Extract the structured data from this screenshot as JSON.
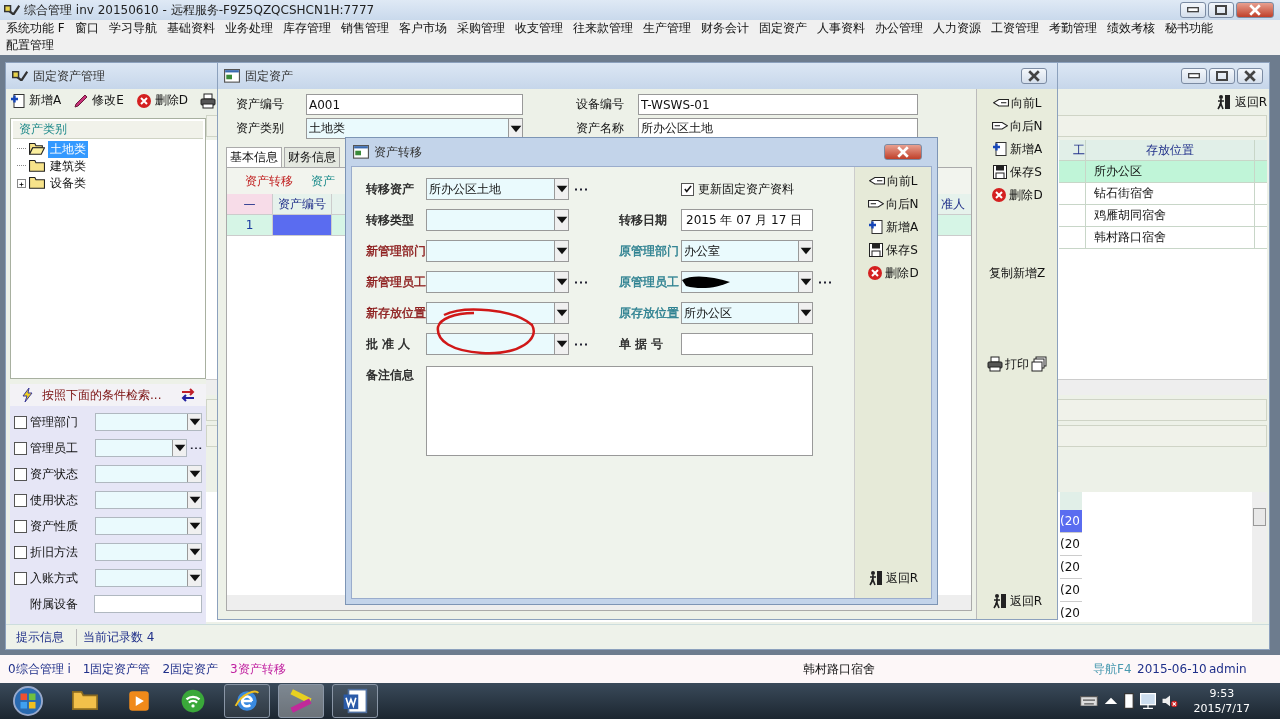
{
  "title_bar": {
    "title": "综合管理 inv 20150610 - 远程服务-F9Z5QZQCSHCN1H:7777"
  },
  "menu": [
    "系统功能 F",
    "窗口",
    "学习导航",
    "基础资料",
    "业务处理",
    "库存管理",
    "销售管理",
    "客户市场",
    "采购管理",
    "收支管理",
    "往来款管理",
    "生产管理",
    "财务会计",
    "固定资产",
    "人事资料",
    "办公管理",
    "人力资源",
    "工资管理",
    "考勤管理",
    "绩效考核",
    "秘书功能",
    "配置管理"
  ],
  "asset_manager": {
    "title": "固定资产管理",
    "toolbar": [
      {
        "label": "新增A",
        "kind": "new"
      },
      {
        "label": "修改E",
        "kind": "edit"
      },
      {
        "label": "删除D",
        "kind": "delete"
      },
      {
        "kind": "print"
      }
    ],
    "tree_header": "资产类别",
    "tree": [
      {
        "label": "土地类",
        "selected": true,
        "expandable": false
      },
      {
        "label": "建筑类",
        "selected": false,
        "expandable": false
      },
      {
        "label": "设备类",
        "selected": false,
        "expandable": true
      }
    ],
    "search_title": "按照下面的条件检索...",
    "filters": [
      {
        "label": "管理部门",
        "kind": "combo",
        "checked": false
      },
      {
        "label": "管理员工",
        "kind": "combo_browse",
        "checked": false
      },
      {
        "label": "资产状态",
        "kind": "combo",
        "checked": false
      },
      {
        "label": "使用状态",
        "kind": "combo",
        "checked": false
      },
      {
        "label": "资产性质",
        "kind": "combo",
        "checked": false
      },
      {
        "label": "折旧方法",
        "kind": "combo",
        "checked": false
      },
      {
        "label": "入账方式",
        "kind": "combo",
        "checked": false
      },
      {
        "label": "附属设备",
        "kind": "text"
      }
    ],
    "return_button": "返回R",
    "grid": {
      "columns": [
        "工",
        "存放位置"
      ],
      "rows": [
        {
          "location": "所办公区",
          "selected": true
        },
        {
          "location": "钻石街宿舍",
          "selected": false
        },
        {
          "location": "鸡雁胡同宿舍",
          "selected": false
        },
        {
          "location": "韩村路口宿舍",
          "selected": false
        }
      ]
    },
    "lower_cells": [
      {
        "text": "(20",
        "selected": true
      },
      {
        "text": "(20",
        "selected": false
      },
      {
        "text": "(20",
        "selected": false
      },
      {
        "text": "(20",
        "selected": false
      },
      {
        "text": "(20",
        "selected": false
      }
    ],
    "status": {
      "hint": "提示信息",
      "records": "当前记录数 4"
    }
  },
  "asset_card": {
    "title": "固定资产",
    "fields": [
      {
        "label": "资产编号",
        "value": "A001",
        "kind": "text"
      },
      {
        "label": "设备编号",
        "value": "T-WSWS-01",
        "kind": "text"
      },
      {
        "label": "资产类别",
        "value": "土地类",
        "kind": "combo"
      },
      {
        "label": "资产名称",
        "value": "所办公区土地",
        "kind": "text"
      }
    ],
    "tabs": [
      {
        "label": "基本信息",
        "selected": true
      },
      {
        "label": "财务信息",
        "selected": false
      }
    ],
    "subtabs": [
      {
        "label": "资产转移",
        "selected": true
      },
      {
        "label": "资产",
        "selected": false
      }
    ],
    "grid": {
      "columns": [
        "—",
        "资产编号",
        "准人"
      ],
      "rows": [
        {
          "number": "1",
          "selected": true
        }
      ]
    },
    "buttons": [
      {
        "label": "向前L",
        "kind": "prev"
      },
      {
        "label": "向后N",
        "kind": "next"
      },
      {
        "label": "新增A",
        "kind": "new"
      },
      {
        "label": "保存S",
        "kind": "save"
      },
      {
        "label": "删除D",
        "kind": "delete"
      },
      {
        "label": "复制新增Z",
        "kind": "copy"
      },
      {
        "label": "打印",
        "kind": "print"
      },
      {
        "label": "返回R",
        "kind": "return"
      }
    ]
  },
  "transfer_dialog": {
    "title": "资产转移",
    "rows": [
      {
        "left": {
          "label": "转移资产",
          "kind": "combo_browse",
          "value": "所办公区土地",
          "color": "#222222"
        },
        "right": {
          "label": "更新固定资产资料",
          "kind": "checkbox",
          "checked": true
        }
      },
      {
        "left": {
          "label": "转移类型",
          "kind": "combo",
          "color": "#222222"
        },
        "right": {
          "label": "转移日期",
          "kind": "date",
          "value": "2015 年 07 月 17 日",
          "color": "#222222"
        }
      },
      {
        "left": {
          "label": "新管理部门",
          "kind": "combo",
          "color": "#8b1a1a"
        },
        "right": {
          "label": "原管理部门",
          "kind": "combo",
          "value": "办公室",
          "color": "#2a7f8f"
        }
      },
      {
        "left": {
          "label": "新管理员工",
          "kind": "combo_browse",
          "color": "#8b1a1a"
        },
        "right": {
          "label": "原管理员工",
          "kind": "combo_browse",
          "redacted": true,
          "color": "#2a7f8f"
        }
      },
      {
        "left": {
          "label": "新存放位置",
          "kind": "combo",
          "color": "#8b1a1a"
        },
        "right": {
          "label": "原存放位置",
          "kind": "combo",
          "value": "所办公区",
          "color": "#2a7f8f"
        }
      },
      {
        "left": {
          "label": "批 准 人",
          "kind": "combo_browse",
          "circled": true,
          "color": "#222222"
        },
        "right": {
          "label": "单 据 号",
          "kind": "text",
          "color": "#222222"
        }
      },
      {
        "left": {
          "label": "备注信息",
          "kind": "memo",
          "color": "#222222"
        }
      }
    ],
    "buttons": [
      {
        "label": "向前L",
        "kind": "prev"
      },
      {
        "label": "向后N",
        "kind": "next"
      },
      {
        "label": "新增A",
        "kind": "new"
      },
      {
        "label": "保存S",
        "kind": "save"
      },
      {
        "label": "删除D",
        "kind": "delete"
      },
      {
        "label": "返回R",
        "kind": "return"
      }
    ]
  },
  "window_tabs": [
    {
      "label": "0综合管理 i",
      "selected": false
    },
    {
      "label": "1固定资产管",
      "selected": false
    },
    {
      "label": "2固定资产",
      "selected": false
    },
    {
      "label": "3资产转移",
      "selected": true
    }
  ],
  "status": {
    "location": "韩村路口宿舍",
    "nav": "导航F4",
    "date": "2015-06-10",
    "user": "admin"
  },
  "taskbar": {
    "apps": [
      {
        "kind": "folder",
        "running": false,
        "active": false
      },
      {
        "kind": "media",
        "running": false,
        "active": false
      },
      {
        "kind": "wifi",
        "running": false,
        "active": false
      },
      {
        "kind": "browser",
        "running": true,
        "active": false
      },
      {
        "kind": "tool",
        "running": true,
        "active": true
      },
      {
        "kind": "word",
        "running": true,
        "active": false
      }
    ],
    "time": "9:53",
    "date": "2015/7/17"
  }
}
